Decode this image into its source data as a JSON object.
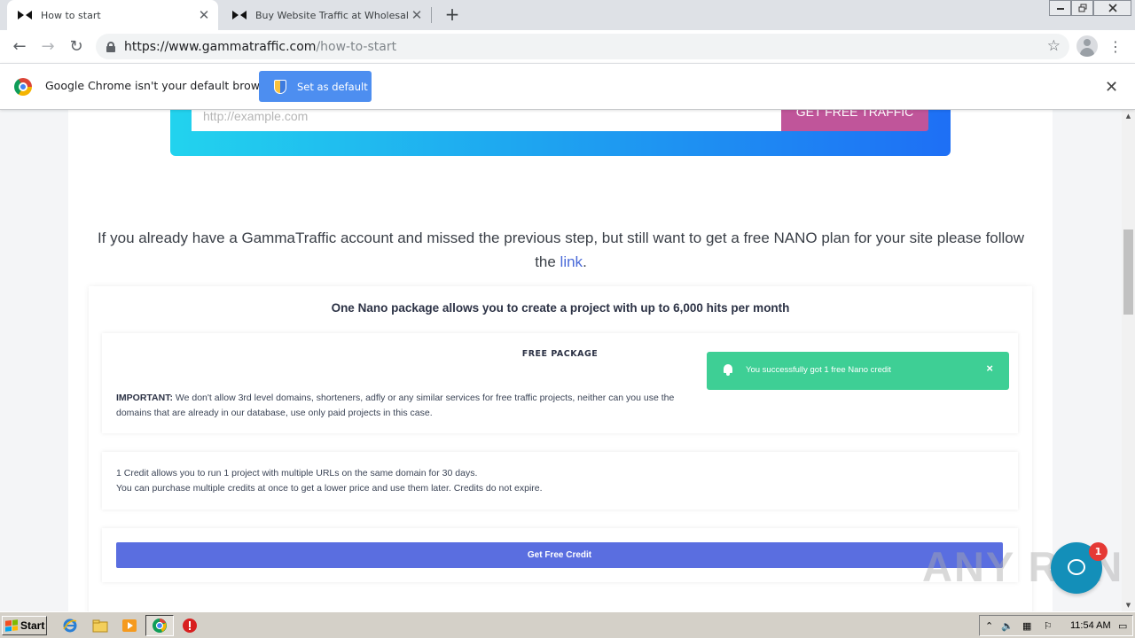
{
  "browser": {
    "tabs": [
      {
        "title": "How to start",
        "active": true
      },
      {
        "title": "Buy Website Traffic at Wholesale Ra",
        "active": false
      }
    ],
    "tab_close_glyph": "✕",
    "new_tab_glyph": "+",
    "address": {
      "host": "https://www.gammatraffic.com",
      "path": "/how-to-start"
    },
    "nav": {
      "back": "←",
      "forward": "→",
      "reload": "↻"
    },
    "bookmark_glyph": "☆",
    "menu_glyph": "⋮",
    "infobar": {
      "message": "Google Chrome isn't your default browser",
      "button_label": "Set as default",
      "close_glyph": "✕"
    }
  },
  "page": {
    "url_placeholder": "http://example.com",
    "get_traffic_label": "GET FREE TRAFFIC",
    "lead": {
      "before_link": "If you already have a GammaTraffic account and missed the previous step, but still want to get a free NANO plan for your site please follow the ",
      "link_text": "link",
      "after_link": "."
    },
    "package": {
      "headline": "One Nano package allows you to create a project with up to 6,000 hits per month",
      "free_package_label": "FREE PACKAGE",
      "important_label": "IMPORTANT:",
      "important_text": " We don't allow 3rd level domains, shorteners, adfly or any similar services for free traffic projects, neither can you use the domains that are already in our database, use only paid projects in this case.",
      "credit_line1": "1 Credit allows you to run 1 project with multiple URLs on the same domain for 30 days.",
      "credit_line2": "You can purchase multiple credits at once to get a lower price and use them later. Credits do not expire.",
      "get_credit_label": "Get Free Credit"
    },
    "toast": {
      "message": "You successfully got 1 free Nano credit",
      "close_glyph": "×"
    },
    "chat_badge_count": "1",
    "watermark": "ANY RUN"
  },
  "taskbar": {
    "start_label": "Start",
    "clock": "11:54 AM",
    "icons": [
      "ie-icon",
      "folder-icon",
      "media-player-icon",
      "chrome-icon",
      "stop-icon"
    ]
  },
  "colors": {
    "accent_blue": "#4d8ef0",
    "hero_gradient_start": "#22d3ee",
    "hero_gradient_end": "#1e6ff5",
    "traffic_button": "#c0559a",
    "toast_green": "#3ecf95",
    "credit_button": "#5a6ee0",
    "chat_button": "#138fb9"
  }
}
